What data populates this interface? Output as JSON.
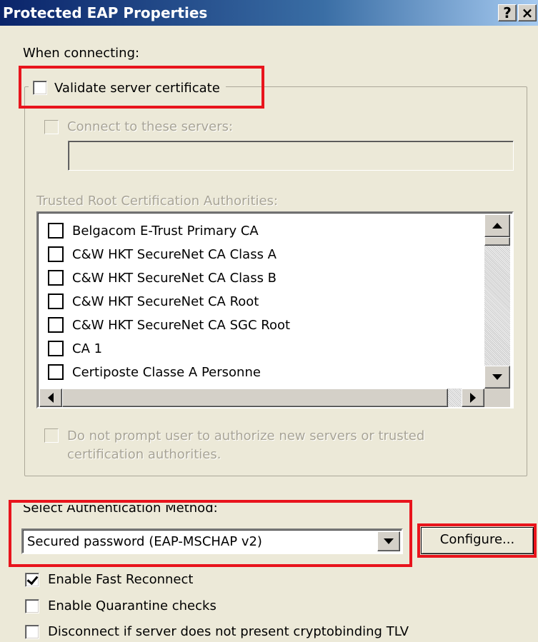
{
  "window": {
    "title": "Protected EAP Properties",
    "help_label": "?",
    "close_label": "×"
  },
  "when_connecting_label": "When connecting:",
  "validate_cert": {
    "label": "Validate server certificate",
    "checked": false
  },
  "connect_servers": {
    "label": "Connect to these servers:",
    "value": ""
  },
  "trusted_root_label": "Trusted Root Certification Authorities:",
  "ca_list": [
    "Belgacom E-Trust Primary CA",
    "C&W HKT SecureNet CA Class A",
    "C&W HKT SecureNet CA Class B",
    "C&W HKT SecureNet CA Root",
    "C&W HKT SecureNet CA SGC Root",
    "CA 1",
    "Certiposte Classe A Personne"
  ],
  "no_prompt": {
    "line1": "Do not prompt user to authorize new servers or trusted",
    "line2": "certification authorities."
  },
  "auth_method": {
    "label": "Select Authentication Method:",
    "selected": "Secured password (EAP-MSCHAP v2)",
    "configure_label": "Configure..."
  },
  "options": [
    {
      "label": "Enable Fast Reconnect",
      "checked": true
    },
    {
      "label": "Enable Quarantine checks",
      "checked": false
    },
    {
      "label": "Disconnect if server does not present cryptobinding TLV",
      "checked": false
    }
  ],
  "colors": {
    "dialog_bg": "#ece9d8",
    "highlight": "#e8141c",
    "title_bar": "#0a246a"
  }
}
